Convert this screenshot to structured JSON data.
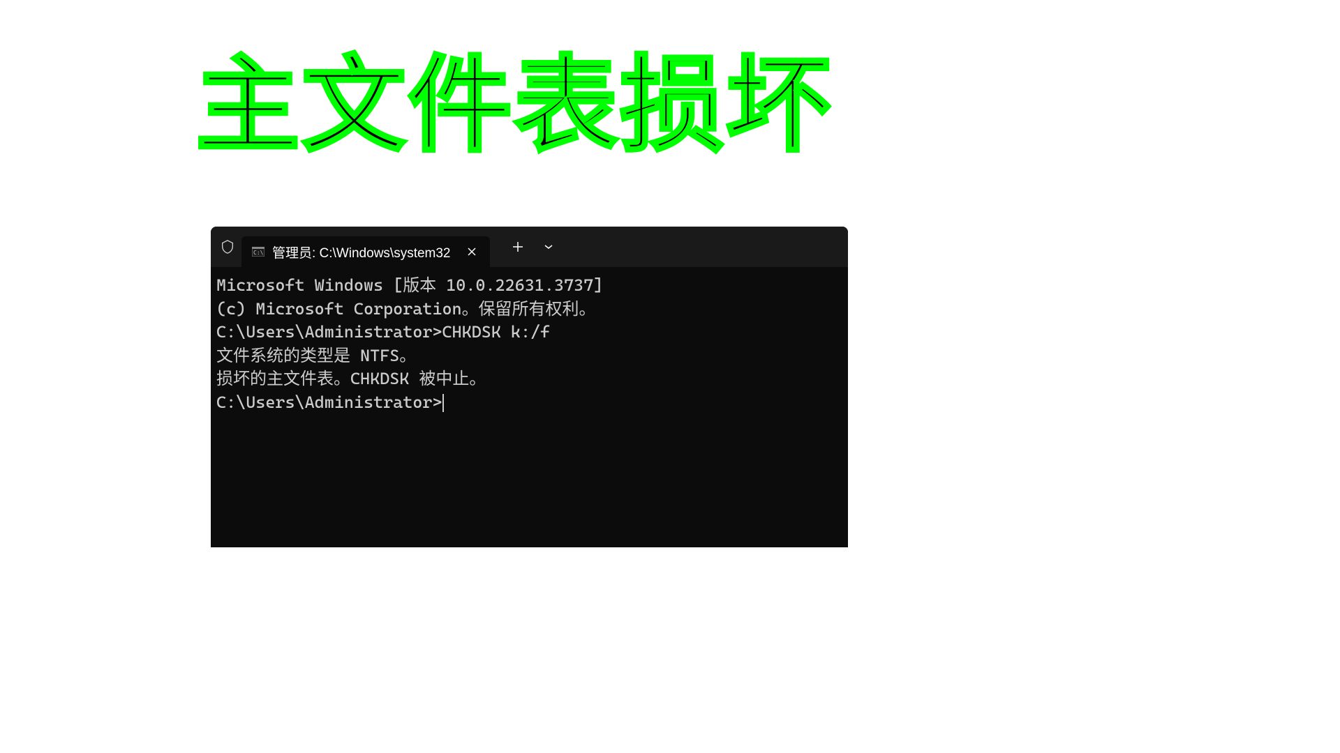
{
  "page": {
    "title": "主文件表损坏"
  },
  "terminal": {
    "tab": {
      "title": "管理员: C:\\Windows\\system32"
    },
    "lines": [
      "Microsoft Windows [版本 10.0.22631.3737]",
      "(c) Microsoft Corporation。保留所有权利。",
      "",
      "C:\\Users\\Administrator>CHKDSK k:/f",
      "文件系统的类型是 NTFS。",
      "损坏的主文件表。CHKDSK 被中止。",
      "",
      "C:\\Users\\Administrator>"
    ]
  }
}
